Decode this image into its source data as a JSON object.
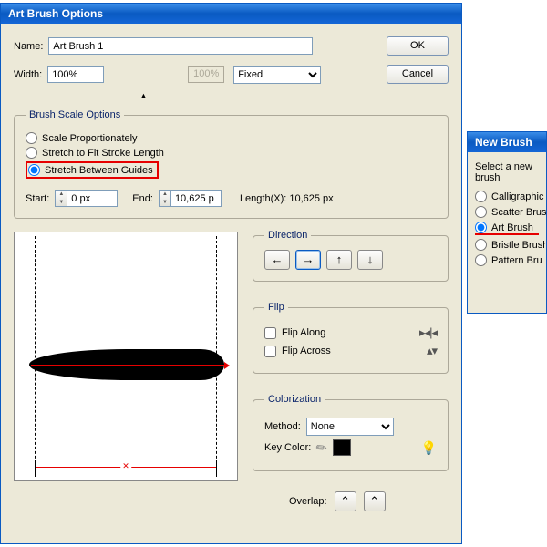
{
  "main": {
    "title": "Art Brush Options",
    "nameLabel": "Name:",
    "nameValue": "Art Brush 1",
    "widthLabel": "Width:",
    "widthValue": "100%",
    "widthDisabled": "100%",
    "widthMode": "Fixed",
    "okLabel": "OK",
    "cancelLabel": "Cancel",
    "scale": {
      "legend": "Brush Scale Options",
      "opt1": "Scale Proportionately",
      "opt2": "Stretch to Fit Stroke Length",
      "opt3": "Stretch Between Guides",
      "startLabel": "Start:",
      "startValue": "0 px",
      "endLabel": "End:",
      "endValue": "10,625 p",
      "lengthLabel": "Length(X): 10,625 px"
    },
    "direction": {
      "legend": "Direction"
    },
    "flip": {
      "legend": "Flip",
      "along": "Flip Along",
      "across": "Flip Across"
    },
    "colorization": {
      "legend": "Colorization",
      "methodLabel": "Method:",
      "methodValue": "None",
      "keyLabel": "Key Color:"
    },
    "overlapLabel": "Overlap:"
  },
  "newBrush": {
    "title": "New Brush",
    "prompt": "Select a new brush",
    "opts": [
      "Calligraphic",
      "Scatter Brus",
      "Art Brush",
      "Bristle Brush",
      "Pattern Bru"
    ]
  }
}
